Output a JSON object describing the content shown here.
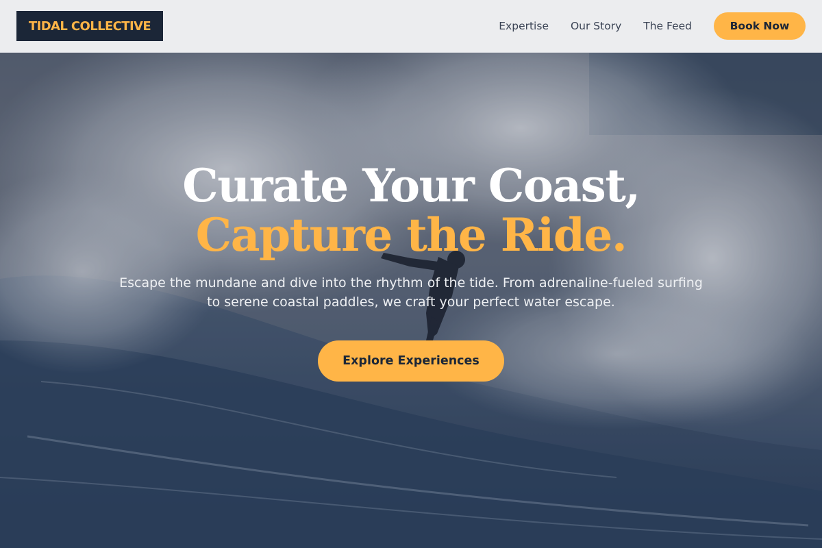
{
  "header": {
    "logo": "TIDAL COLLECTIVE",
    "nav": [
      {
        "label": "Expertise"
      },
      {
        "label": "Our Story"
      },
      {
        "label": "The Feed"
      }
    ],
    "book_label": "Book Now"
  },
  "hero": {
    "title_line1": "Curate Your Coast,",
    "title_line2": "Capture the Ride.",
    "subtitle": "Escape the mundane and dive into the rhythm of the tide. From adrenaline-fueled surfing to serene coastal paddles, we craft your perfect water escape.",
    "cta_label": "Explore Experiences",
    "image_subject": "surfer-riding-wave"
  },
  "colors": {
    "accent": "#ffb547",
    "navy": "#1b2637",
    "header_bg": "#ecedef"
  }
}
